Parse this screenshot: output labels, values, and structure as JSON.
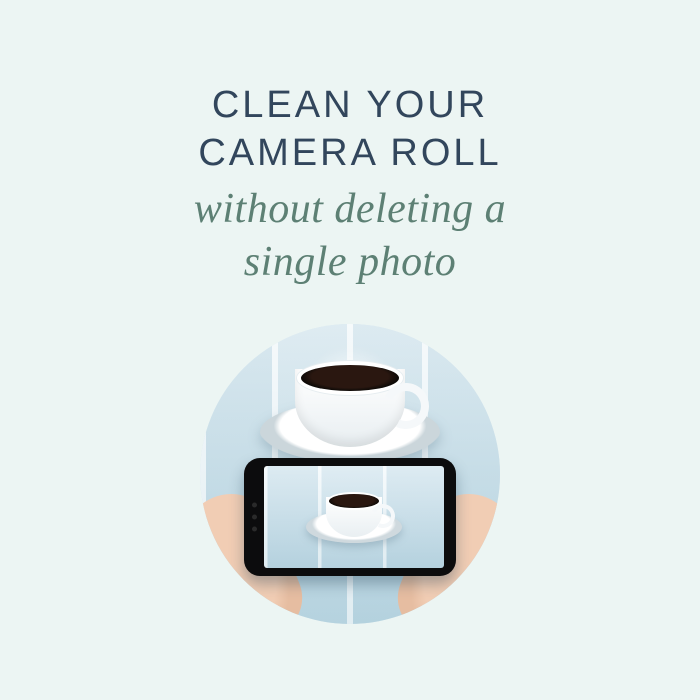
{
  "headline": {
    "primary_line1": "CLEAN YOUR",
    "primary_line2": "CAMERA ROLL",
    "secondary_line1": "without deleting a",
    "secondary_line2": "single photo"
  },
  "image": {
    "alt": "Hands holding a smartphone photographing a white coffee cup on a light blue wooden table; the same cup appears on the phone screen."
  },
  "colors": {
    "background": "#ecf5f3",
    "primary_text": "#32465c",
    "secondary_text": "#5d8074"
  }
}
